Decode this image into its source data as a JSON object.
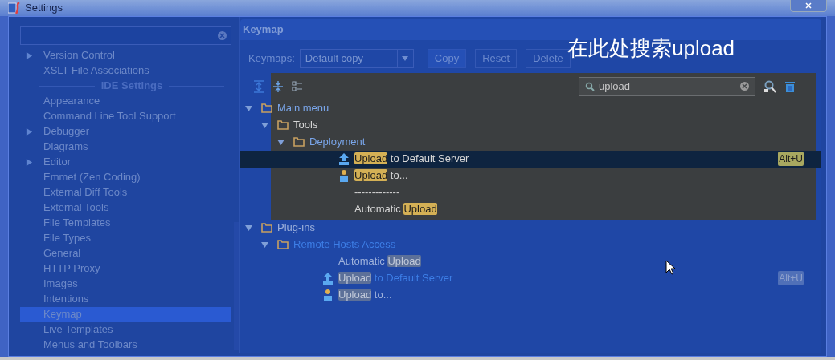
{
  "window": {
    "title": "Settings"
  },
  "sidebar": {
    "items": [
      {
        "kind": "item",
        "label": "Version Control",
        "expandable": true,
        "selected": false
      },
      {
        "kind": "item",
        "label": "XSLT File Associations",
        "expandable": false,
        "selected": false
      },
      {
        "kind": "header",
        "label": "IDE Settings"
      },
      {
        "kind": "item",
        "label": "Appearance",
        "expandable": false,
        "selected": false
      },
      {
        "kind": "item",
        "label": "Command Line Tool Support",
        "expandable": false,
        "selected": false
      },
      {
        "kind": "item",
        "label": "Debugger",
        "expandable": true,
        "selected": false
      },
      {
        "kind": "item",
        "label": "Diagrams",
        "expandable": false,
        "selected": false
      },
      {
        "kind": "item",
        "label": "Editor",
        "expandable": true,
        "selected": false
      },
      {
        "kind": "item",
        "label": "Emmet (Zen Coding)",
        "expandable": false,
        "selected": false
      },
      {
        "kind": "item",
        "label": "External Diff Tools",
        "expandable": false,
        "selected": false
      },
      {
        "kind": "item",
        "label": "External Tools",
        "expandable": false,
        "selected": false
      },
      {
        "kind": "item",
        "label": "File Templates",
        "expandable": false,
        "selected": false
      },
      {
        "kind": "item",
        "label": "File Types",
        "expandable": false,
        "selected": false
      },
      {
        "kind": "item",
        "label": "General",
        "expandable": false,
        "selected": false
      },
      {
        "kind": "item",
        "label": "HTTP Proxy",
        "expandable": false,
        "selected": false
      },
      {
        "kind": "item",
        "label": "Images",
        "expandable": false,
        "selected": false
      },
      {
        "kind": "item",
        "label": "Intentions",
        "expandable": false,
        "selected": false
      },
      {
        "kind": "item",
        "label": "Keymap",
        "expandable": false,
        "selected": true
      },
      {
        "kind": "item",
        "label": "Live Templates",
        "expandable": false,
        "selected": false
      },
      {
        "kind": "item",
        "label": "Menus and Toolbars",
        "expandable": false,
        "selected": false
      }
    ]
  },
  "panel": {
    "title": "Keymap",
    "keymaps_label": "Keymaps:",
    "keymap_value": "Default copy",
    "buttons": [
      {
        "label": "Copy",
        "disabled": false
      },
      {
        "label": "Reset",
        "disabled": true
      },
      {
        "label": "Delete",
        "disabled": true
      }
    ],
    "annotation": "在此处搜索upload",
    "search": {
      "value": "upload"
    },
    "tree": [
      {
        "kind": "folder",
        "expanded": true,
        "modified": true,
        "spotlit": true,
        "parts": [
          {
            "text": "Main menu",
            "match": false
          }
        ],
        "children": [
          {
            "kind": "folder",
            "expanded": true,
            "modified": false,
            "parts": [
              {
                "text": "Tools",
                "match": false
              }
            ],
            "children": [
              {
                "kind": "folder",
                "expanded": true,
                "modified": true,
                "parts": [
                  {
                    "text": "Deployment",
                    "match": false
                  }
                ],
                "children": [
                  {
                    "kind": "upload",
                    "selected": true,
                    "modified": false,
                    "shortcut": "Alt+U",
                    "parts": [
                      {
                        "text": "Upload",
                        "match": true
                      },
                      {
                        "text": " to Default Server",
                        "match": false
                      }
                    ]
                  },
                  {
                    "kind": "upload_to",
                    "selected": false,
                    "modified": false,
                    "parts": [
                      {
                        "text": "Upload",
                        "match": true
                      },
                      {
                        "text": " to...",
                        "match": false
                      }
                    ]
                  },
                  {
                    "kind": "plain",
                    "selected": false,
                    "modified": false,
                    "parts": [
                      {
                        "text": "-------------",
                        "match": false
                      }
                    ]
                  },
                  {
                    "kind": "plain",
                    "selected": false,
                    "modified": false,
                    "parts": [
                      {
                        "text": "Automatic ",
                        "match": false
                      },
                      {
                        "text": "Upload",
                        "match": true
                      }
                    ]
                  }
                ]
              }
            ]
          }
        ]
      },
      {
        "kind": "folder",
        "expanded": true,
        "modified": false,
        "spotlit": false,
        "parts": [
          {
            "text": "Plug-ins",
            "match": false
          }
        ],
        "children": [
          {
            "kind": "folder",
            "expanded": true,
            "modified": true,
            "parts": [
              {
                "text": "Remote Hosts Access",
                "match": false
              }
            ],
            "children": [
              {
                "kind": "plain",
                "selected": false,
                "modified": false,
                "parts": [
                  {
                    "text": "Automatic ",
                    "match": false
                  },
                  {
                    "text": "Upload",
                    "match": true
                  }
                ]
              },
              {
                "kind": "upload",
                "selected": false,
                "modified": true,
                "shortcut": "Alt+U",
                "parts": [
                  {
                    "text": "Upload",
                    "match": true
                  },
                  {
                    "text": " to Default Server",
                    "match": false
                  }
                ]
              },
              {
                "kind": "upload_to",
                "selected": false,
                "modified": false,
                "parts": [
                  {
                    "text": "Upload",
                    "match": true
                  },
                  {
                    "text": " to...",
                    "match": false
                  }
                ]
              }
            ]
          }
        ]
      }
    ]
  }
}
